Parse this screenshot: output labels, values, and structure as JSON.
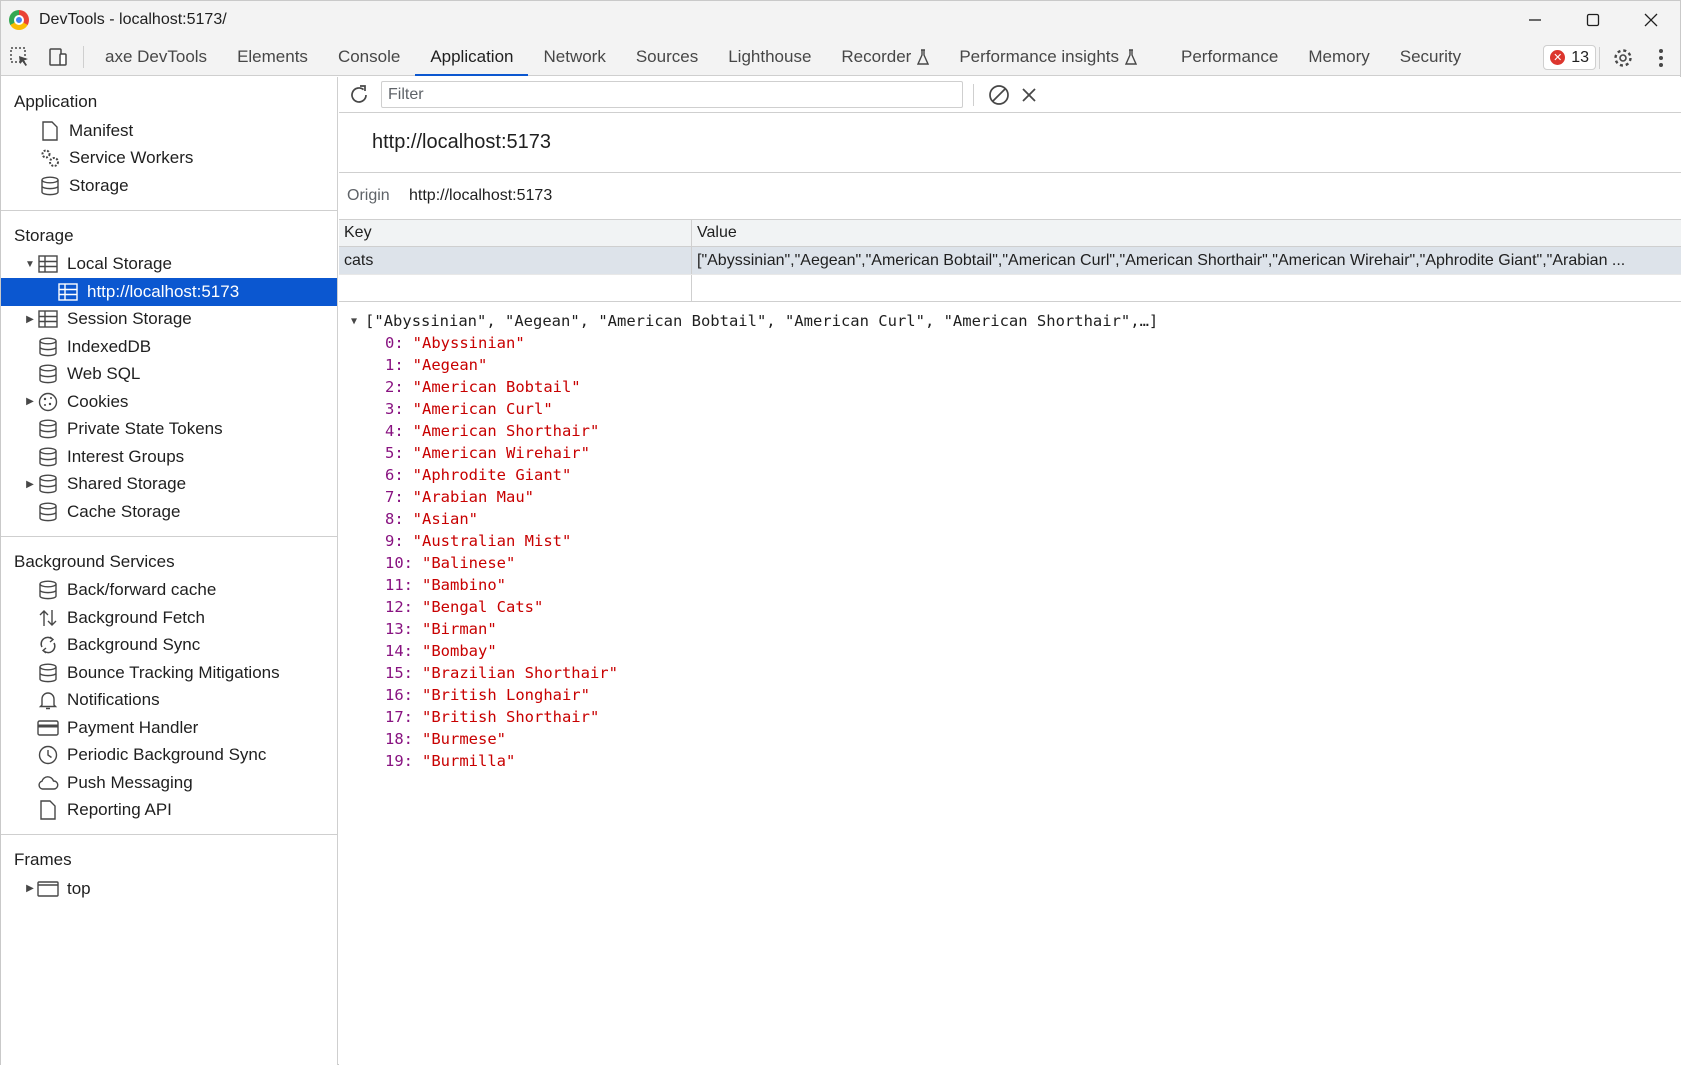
{
  "window": {
    "title": "DevTools - localhost:5173/",
    "minimize": "—",
    "maximize": "☐",
    "close": "✕"
  },
  "tabs": [
    {
      "label": "axe DevTools"
    },
    {
      "label": "Elements"
    },
    {
      "label": "Console"
    },
    {
      "label": "Application"
    },
    {
      "label": "Network"
    },
    {
      "label": "Sources"
    },
    {
      "label": "Lighthouse"
    },
    {
      "label": "Recorder"
    },
    {
      "label": "Performance insights"
    },
    {
      "label": "Performance"
    },
    {
      "label": "Memory"
    },
    {
      "label": "Security"
    }
  ],
  "active_tab": "Application",
  "error_count": "13",
  "sidebar": {
    "application": {
      "title": "Application",
      "items": [
        "Manifest",
        "Service Workers",
        "Storage"
      ]
    },
    "storage": {
      "title": "Storage",
      "local_storage": "Local Storage",
      "local_storage_origin": "http://localhost:5173",
      "items": [
        "Session Storage",
        "IndexedDB",
        "Web SQL",
        "Cookies",
        "Private State Tokens",
        "Interest Groups",
        "Shared Storage",
        "Cache Storage"
      ]
    },
    "background": {
      "title": "Background Services",
      "items": [
        "Back/forward cache",
        "Background Fetch",
        "Background Sync",
        "Bounce Tracking Mitigations",
        "Notifications",
        "Payment Handler",
        "Periodic Background Sync",
        "Push Messaging",
        "Reporting API"
      ]
    },
    "frames": {
      "title": "Frames",
      "items": [
        "top"
      ]
    }
  },
  "main": {
    "filter_placeholder": "Filter",
    "origin_header": "http://localhost:5173",
    "origin_label": "Origin",
    "origin_value": "http://localhost:5173",
    "columns": {
      "key": "Key",
      "value": "Value"
    },
    "rows": [
      {
        "key": "cats",
        "value": "[\"Abyssinian\",\"Aegean\",\"American Bobtail\",\"American Curl\",\"American Shorthair\",\"American Wirehair\",\"Aphrodite Giant\",\"Arabian ..."
      }
    ],
    "preview_summary": "[\"Abyssinian\", \"Aegean\", \"American Bobtail\", \"American Curl\", \"American Shorthair\",…]",
    "preview_items": [
      {
        "index": "0:",
        "value": "\"Abyssinian\""
      },
      {
        "index": "1:",
        "value": "\"Aegean\""
      },
      {
        "index": "2:",
        "value": "\"American Bobtail\""
      },
      {
        "index": "3:",
        "value": "\"American Curl\""
      },
      {
        "index": "4:",
        "value": "\"American Shorthair\""
      },
      {
        "index": "5:",
        "value": "\"American Wirehair\""
      },
      {
        "index": "6:",
        "value": "\"Aphrodite Giant\""
      },
      {
        "index": "7:",
        "value": "\"Arabian Mau\""
      },
      {
        "index": "8:",
        "value": "\"Asian\""
      },
      {
        "index": "9:",
        "value": "\"Australian Mist\""
      },
      {
        "index": "10:",
        "value": "\"Balinese\""
      },
      {
        "index": "11:",
        "value": "\"Bambino\""
      },
      {
        "index": "12:",
        "value": "\"Bengal Cats\""
      },
      {
        "index": "13:",
        "value": "\"Birman\""
      },
      {
        "index": "14:",
        "value": "\"Bombay\""
      },
      {
        "index": "15:",
        "value": "\"Brazilian Shorthair\""
      },
      {
        "index": "16:",
        "value": "\"British Longhair\""
      },
      {
        "index": "17:",
        "value": "\"British Shorthair\""
      },
      {
        "index": "18:",
        "value": "\"Burmese\""
      },
      {
        "index": "19:",
        "value": "\"Burmilla\""
      }
    ]
  },
  "colors": {
    "accent": "#0b57d0",
    "selected_row": "#dde3ea",
    "string_value": "#c80000",
    "index_key": "#881280",
    "error": "#dc362e"
  }
}
